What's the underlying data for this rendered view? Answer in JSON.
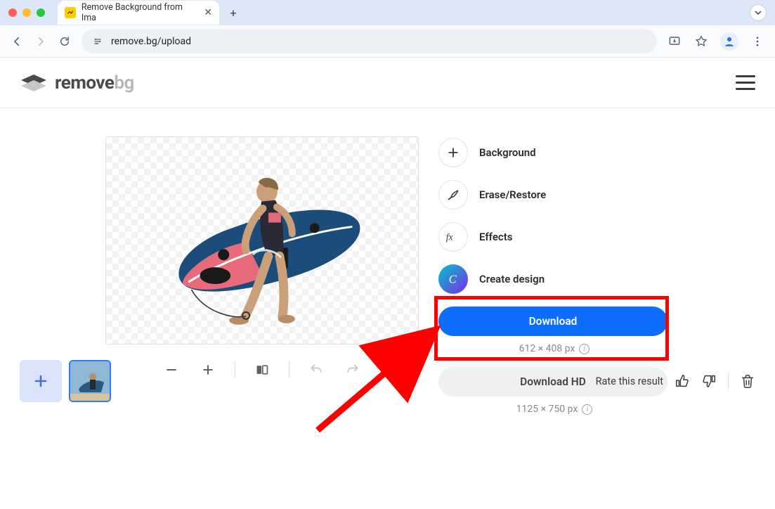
{
  "browser": {
    "tab_title": "Remove Background from Ima",
    "url": "remove.bg/upload"
  },
  "header": {
    "logo_remove": "remove",
    "logo_bg": "bg"
  },
  "tools": {
    "background": "Background",
    "erase_restore": "Erase/Restore",
    "effects": "Effects",
    "create_design": "Create design"
  },
  "downloads": {
    "download_label": "Download",
    "download_dim": "612 × 408 px",
    "download_hd_label": "Download HD",
    "download_hd_dim": "1125 × 750 px"
  },
  "footer": {
    "rate_label": "Rate this result"
  }
}
